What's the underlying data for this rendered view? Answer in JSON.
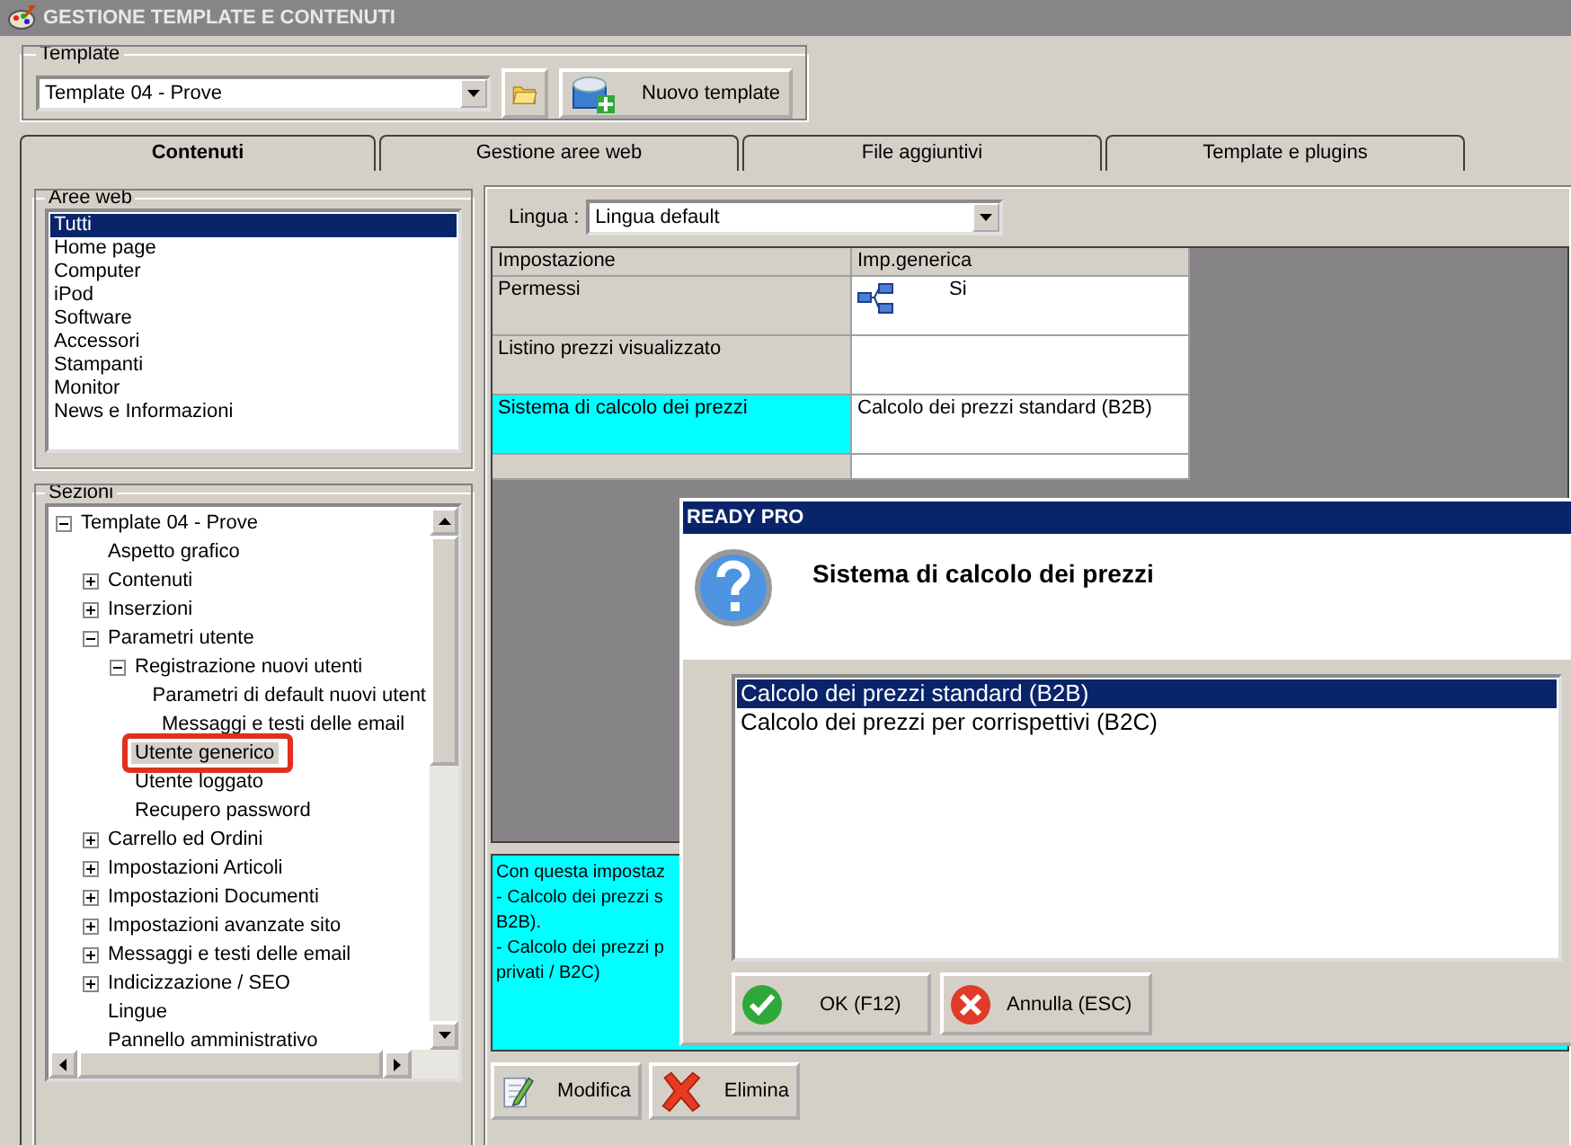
{
  "window": {
    "title": "GESTIONE TEMPLATE E CONTENUTI"
  },
  "template_group": {
    "label": "Template",
    "value": "Template 04 - Prove",
    "new_button": "Nuovo template"
  },
  "tabs": [
    {
      "label": "Contenuti",
      "selected": true
    },
    {
      "label": "Gestione aree web",
      "selected": false
    },
    {
      "label": "File aggiuntivi",
      "selected": false
    },
    {
      "label": "Template e plugins",
      "selected": false
    }
  ],
  "web_areas": {
    "label": "Aree web",
    "items": [
      {
        "label": "Tutti",
        "selected": true
      },
      {
        "label": "Home page",
        "selected": false
      },
      {
        "label": "Computer",
        "selected": false
      },
      {
        "label": "iPod",
        "selected": false
      },
      {
        "label": "Software",
        "selected": false
      },
      {
        "label": "Accessori",
        "selected": false
      },
      {
        "label": "Stampanti",
        "selected": false
      },
      {
        "label": "Monitor",
        "selected": false
      },
      {
        "label": "News e Informazioni",
        "selected": false
      }
    ]
  },
  "sections": {
    "label": "Sezioni",
    "tree": [
      {
        "label": "Template 04 - Prove",
        "expanded": true,
        "selected": false,
        "children": [
          {
            "label": "Aspetto grafico",
            "selected": false
          },
          {
            "label": "Contenuti",
            "expanded": false,
            "selected": false
          },
          {
            "label": "Inserzioni",
            "expanded": false,
            "selected": false
          },
          {
            "label": "Parametri utente",
            "expanded": true,
            "selected": false,
            "children": [
              {
                "label": "Registrazione nuovi utenti",
                "expanded": true,
                "selected": false,
                "children": [
                  {
                    "label": "Parametri di default nuovi utent",
                    "selected": false
                  },
                  {
                    "label": "Messaggi e testi delle email",
                    "selected": false
                  }
                ]
              },
              {
                "label": "Utente generico",
                "selected": true,
                "annotated": true
              },
              {
                "label": "Utente loggato",
                "selected": false
              },
              {
                "label": "Recupero password",
                "selected": false
              }
            ]
          },
          {
            "label": "Carrello ed Ordini",
            "expanded": false,
            "selected": false
          },
          {
            "label": "Impostazioni Articoli",
            "expanded": false,
            "selected": false
          },
          {
            "label": "Impostazioni Documenti",
            "expanded": false,
            "selected": false
          },
          {
            "label": "Impostazioni avanzate sito",
            "expanded": false,
            "selected": false
          },
          {
            "label": "Messaggi e testi delle email",
            "expanded": false,
            "selected": false
          },
          {
            "label": "Indicizzazione / SEO",
            "expanded": false,
            "selected": false
          },
          {
            "label": "Lingue",
            "selected": false
          },
          {
            "label": "Pannello amministrativo",
            "selected": false
          }
        ]
      }
    ]
  },
  "language": {
    "label": "Lingua :",
    "value": "Lingua default"
  },
  "grid": {
    "columns": [
      "Impostazione",
      "Imp.generica"
    ],
    "rows": [
      {
        "kind": "icon",
        "setting": "Permessi",
        "value": "Si",
        "highlighted": false
      },
      {
        "kind": "text",
        "setting": "Listino prezzi visualizzato",
        "highlighted": false
      },
      {
        "kind": "text",
        "setting": "Sistema di calcolo dei prezzi",
        "value": "Calcolo dei prezzi standard (B2B)",
        "highlighted": true
      }
    ]
  },
  "description": [
    "Con questa impostaz",
    "- Calcolo dei prezzi s",
    "B2B).",
    "- Calcolo dei prezzi p",
    "privati / B2C)"
  ],
  "buttons": [
    "Modifica",
    "Elimina"
  ],
  "dialog": {
    "title": "READY PRO",
    "heading": "Sistema di calcolo dei prezzi",
    "options": [
      {
        "label": "Calcolo dei prezzi standard (B2B)",
        "selected": true
      },
      {
        "label": "Calcolo dei prezzi per corrispettivi (B2C)",
        "selected": false
      }
    ],
    "ok": "OK (F12)",
    "cancel": "Annulla (ESC)"
  }
}
